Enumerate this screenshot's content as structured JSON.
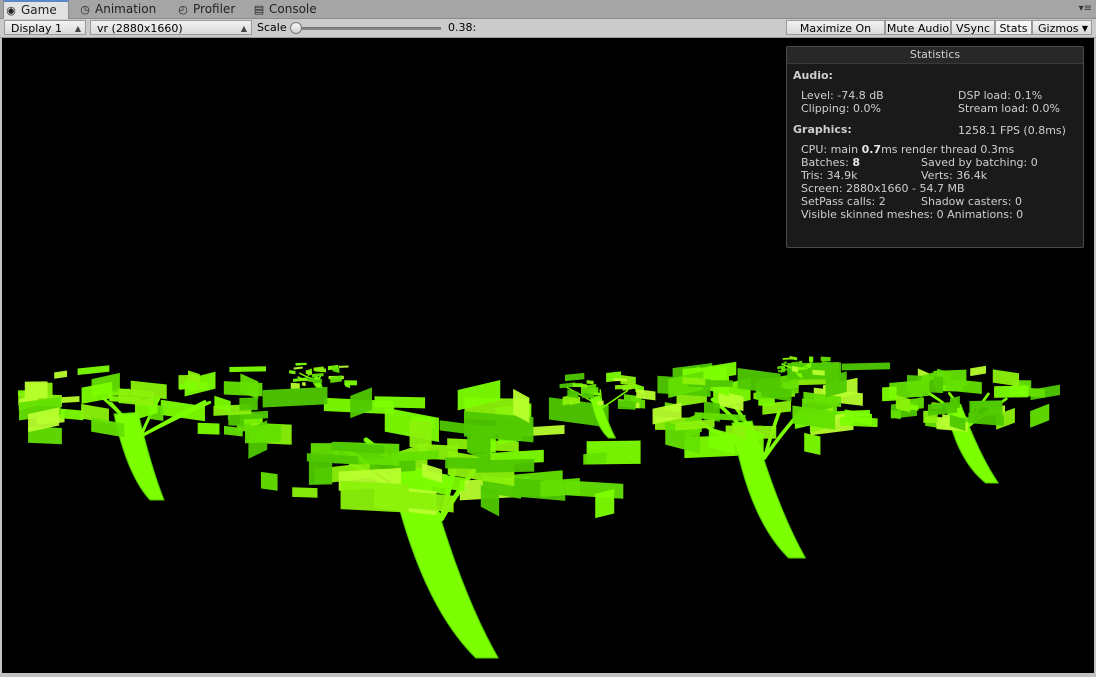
{
  "tabs": [
    {
      "label": "Game",
      "icon": "game-icon"
    },
    {
      "label": "Animation",
      "icon": "animation-icon"
    },
    {
      "label": "Profiler",
      "icon": "profiler-icon"
    },
    {
      "label": "Console",
      "icon": "console-icon"
    }
  ],
  "toolbar": {
    "display": "Display 1",
    "resolution": "vr (2880x1660)",
    "scale_label": "Scale",
    "scale_value": "0.38:",
    "maximize": "Maximize On Play",
    "mute": "Mute Audio",
    "vsync": "VSync",
    "stats": "Stats",
    "gizmos": "Gizmos"
  },
  "stats": {
    "title": "Statistics",
    "audio_header": "Audio:",
    "level": "Level: -74.8 dB",
    "dsp": "DSP load: 0.1%",
    "clipping": "Clipping: 0.0%",
    "stream": "Stream load: 0.0%",
    "graphics_header": "Graphics:",
    "fps": "1258.1 FPS (0.8ms)",
    "cpu_prefix": "CPU: main ",
    "cpu_main": "0.7",
    "cpu_suffix": "ms  render thread 0.3ms",
    "batches_prefix": "Batches: ",
    "batches": "8",
    "saved": "Saved by batching: 0",
    "tris": "Tris: 34.9k",
    "verts": "Verts: 36.4k",
    "screen": "Screen: 2880x1660 - 54.7 MB",
    "setpass": "SetPass calls: 2",
    "shadow": "Shadow casters: 0",
    "skinned": "Visible skinned meshes: 0  Animations: 0"
  },
  "colors": {
    "foliage": "#7cff00",
    "foliage_dark": "#4fc800",
    "foliage_light": "#b8ff2e",
    "viewport_bg": "#000000"
  }
}
